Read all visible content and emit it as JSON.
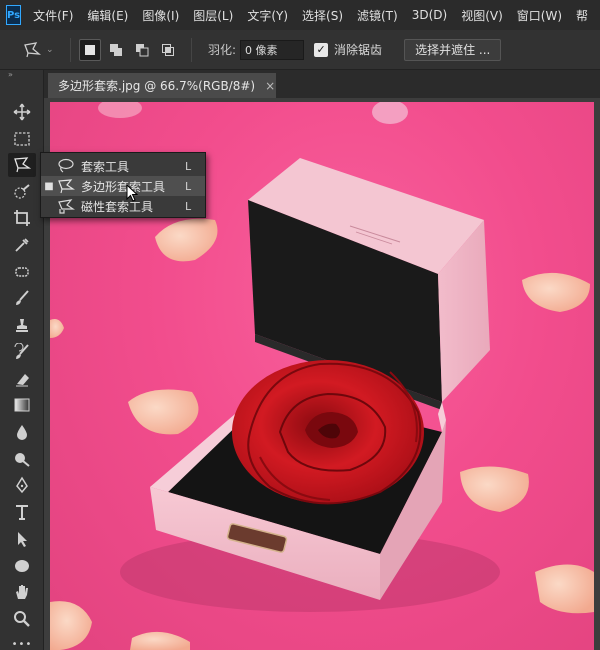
{
  "app": {
    "logo": "Ps"
  },
  "menu": {
    "items": [
      "文件(F)",
      "编辑(E)",
      "图像(I)",
      "图层(L)",
      "文字(Y)",
      "选择(S)",
      "滤镜(T)",
      "3D(D)",
      "视图(V)",
      "窗口(W)",
      "帮"
    ]
  },
  "options": {
    "tool_icon": "polygonal-lasso-icon",
    "feather_label": "羽化:",
    "feather_value": "0 像素",
    "antialias_label": "消除锯齿",
    "antialias_checked": true,
    "select_mask_label": "选择并遮住 ..."
  },
  "tab": {
    "title": "多边形套索.jpg @ 66.7%(RGB/8#)",
    "close": "×"
  },
  "toolbar": {
    "collapse": "»",
    "tools": [
      "move-icon",
      "marquee-icon",
      "polygonal-lasso-icon",
      "quick-select-icon",
      "crop-icon",
      "eyedropper-icon",
      "healing-brush-icon",
      "brush-icon",
      "clone-stamp-icon",
      "history-brush-icon",
      "eraser-icon",
      "gradient-icon",
      "blur-icon",
      "dodge-icon",
      "pen-icon",
      "type-icon",
      "path-select-icon",
      "ellipse-icon",
      "hand-icon",
      "zoom-icon"
    ],
    "more": "•••"
  },
  "flyout": {
    "items": [
      {
        "label": "套索工具",
        "key": "L",
        "icon": "lasso-icon",
        "selected": false
      },
      {
        "label": "多边形套索工具",
        "key": "L",
        "icon": "polygonal-lasso-icon",
        "selected": true
      },
      {
        "label": "磁性套索工具",
        "key": "L",
        "icon": "magnetic-lasso-icon",
        "selected": false
      }
    ]
  },
  "colors": {
    "canvas_pink": "#f24d8d",
    "box_pink": "#f2b8c6",
    "rose_red": "#c8141e",
    "ui_bg": "#323232"
  }
}
